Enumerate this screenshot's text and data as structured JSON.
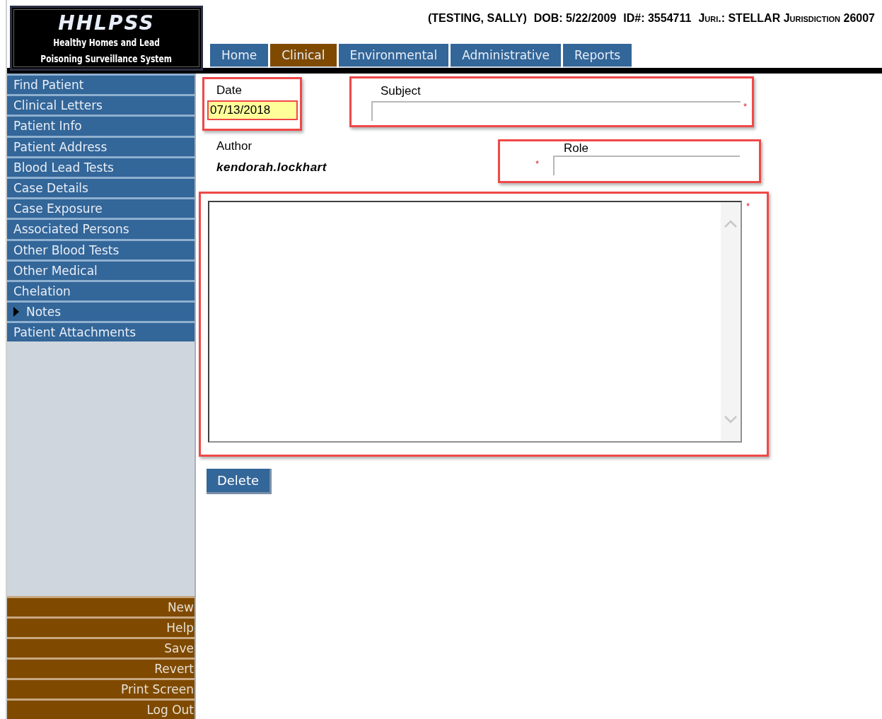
{
  "logo": {
    "title": "HHLPSS",
    "subtitle_lines": [
      "Healthy Homes and Lead",
      "Poisoning Surveillance System"
    ]
  },
  "patient_header": {
    "name": "(TESTING, SALLY)",
    "dob": "DOB: 5/22/2009",
    "id": "ID#: 3554711",
    "jurisdiction": "Juri.: STELLAR Jurisdiction 26007"
  },
  "tabs": [
    {
      "label": "Home",
      "selected": false
    },
    {
      "label": "Clinical",
      "selected": true
    },
    {
      "label": "Environmental",
      "selected": false
    },
    {
      "label": "Administrative",
      "selected": false
    },
    {
      "label": "Reports",
      "selected": false
    }
  ],
  "sidebar": {
    "items": [
      {
        "label": "Find Patient",
        "selected": false
      },
      {
        "label": "Clinical Letters",
        "selected": false
      },
      {
        "label": "Patient Info",
        "selected": false
      },
      {
        "label": "Patient Address",
        "selected": false
      },
      {
        "label": "Blood Lead Tests",
        "selected": false
      },
      {
        "label": "Case Details",
        "selected": false
      },
      {
        "label": "Case Exposure",
        "selected": false
      },
      {
        "label": "Associated Persons",
        "selected": false
      },
      {
        "label": "Other Blood Tests",
        "selected": false
      },
      {
        "label": "Other Medical",
        "selected": false
      },
      {
        "label": "Chelation",
        "selected": false
      },
      {
        "label": "Notes",
        "selected": true
      },
      {
        "label": "Patient Attachments",
        "selected": false
      }
    ],
    "actions": [
      "New",
      "Help",
      "Save",
      "Revert",
      "Print Screen",
      "Log Out"
    ]
  },
  "form": {
    "date": {
      "label": "Date",
      "value": "07/13/2018",
      "highlighted": true
    },
    "subject": {
      "label": "Subject",
      "required_mark": "*",
      "highlighted": true
    },
    "author": {
      "label": "Author",
      "value": "kendorah.lockhart"
    },
    "role": {
      "label": "Role",
      "required_mark": "*",
      "highlighted": true
    },
    "note": {
      "required_mark": "*",
      "highlighted": true
    },
    "delete_button": "Delete"
  }
}
